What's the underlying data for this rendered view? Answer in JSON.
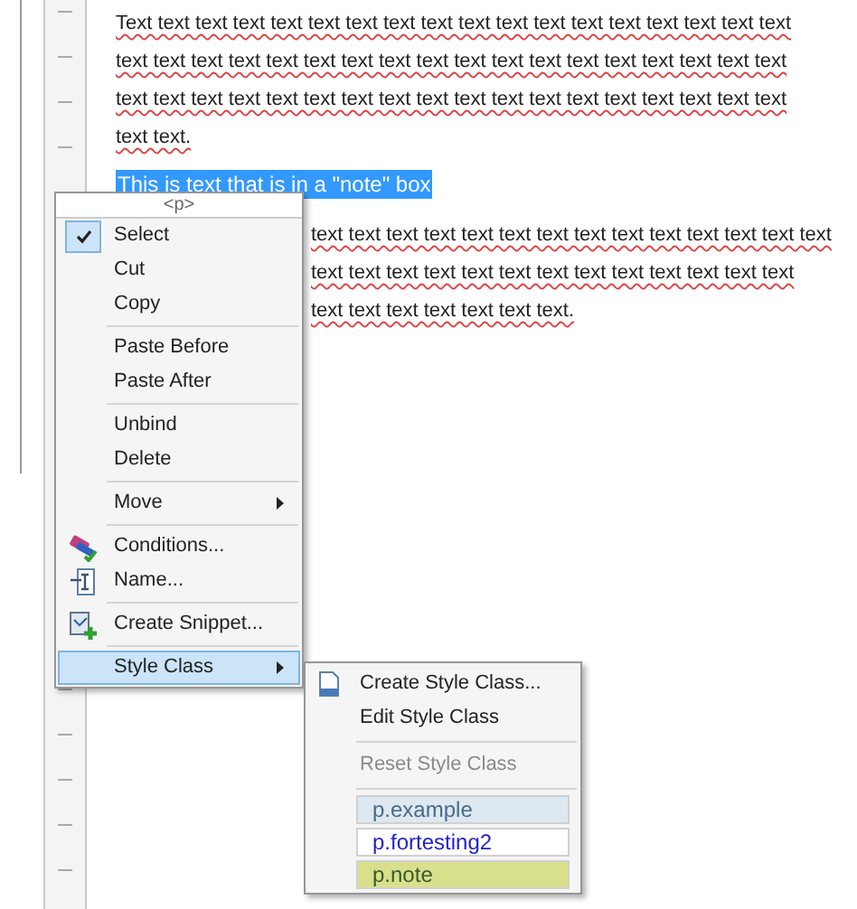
{
  "paragraph_1": {
    "lines": [
      "Text text text text text text text text text text text text text text text text text text",
      "text text text text text text text text text text text text text text text text text text",
      "text text text text text text text text text text text text text text text text text text",
      "text text."
    ]
  },
  "note_box": {
    "text": "This is text that is in a \"note\" box",
    "selected": true
  },
  "paragraph_2": {
    "lines": [
      "text text text text text text text text text text text text text text",
      "text text text text text text text text text text text text text",
      "text text text text text text text."
    ]
  },
  "context_menu": {
    "title": "<p>",
    "groups": [
      [
        {
          "label": "Select",
          "checked": true,
          "submenu": false,
          "selected": false
        },
        {
          "label": "Cut",
          "checked": false,
          "submenu": false,
          "selected": false
        },
        {
          "label": "Copy",
          "checked": false,
          "submenu": false,
          "selected": false
        }
      ],
      [
        {
          "label": "Paste Before",
          "checked": false,
          "submenu": false,
          "selected": false
        },
        {
          "label": "Paste After",
          "checked": false,
          "submenu": false,
          "selected": false
        }
      ],
      [
        {
          "label": "Unbind",
          "checked": false,
          "submenu": false,
          "selected": false
        },
        {
          "label": "Delete",
          "checked": false,
          "submenu": false,
          "selected": false
        }
      ],
      [
        {
          "label": "Move",
          "checked": false,
          "submenu": true,
          "selected": false
        }
      ],
      [
        {
          "label": "Conditions...",
          "checked": false,
          "submenu": false,
          "selected": false
        },
        {
          "label": "Name...",
          "checked": false,
          "submenu": false,
          "selected": false
        }
      ],
      [
        {
          "label": "Create Snippet...",
          "checked": false,
          "submenu": false,
          "selected": false
        }
      ],
      [
        {
          "label": "Style Class",
          "checked": false,
          "submenu": true,
          "selected": true
        }
      ]
    ]
  },
  "style_class_menu": {
    "groups": [
      [
        {
          "label": "Create Style Class...",
          "disabled": false
        },
        {
          "label": "Edit Style Class",
          "disabled": false
        }
      ],
      [
        {
          "label": "Reset Style Class",
          "disabled": true
        }
      ]
    ],
    "classes": [
      {
        "label": "p.example",
        "color": "#dde8f0"
      },
      {
        "label": "p.fortesting2",
        "color": "#ffffff"
      },
      {
        "label": "p.note",
        "color": "#d8e08c"
      }
    ]
  }
}
